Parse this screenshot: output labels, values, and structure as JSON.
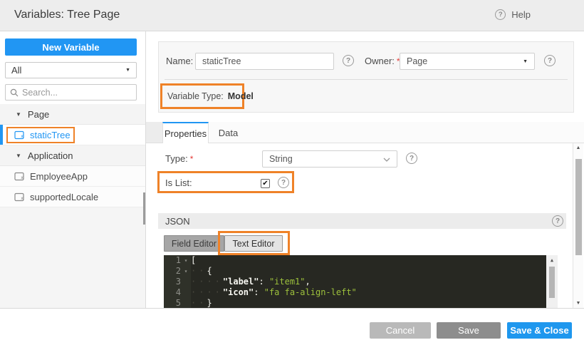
{
  "window": {
    "title": "Variables: Tree Page"
  },
  "header": {
    "help_label": "Help"
  },
  "icons": {
    "help": "?",
    "caret_down": "▼",
    "fold": "▾",
    "check": "✔",
    "scroll_up": "▲",
    "scroll_down": "▼"
  },
  "colors": {
    "accent": "#2196f3",
    "highlight_orange": "#ef8228",
    "editor_bg": "#272822",
    "string_green": "#9dc13c"
  },
  "sidebar": {
    "new_variable_button": "New Variable",
    "filter_value": "All",
    "search_placeholder": "Search...",
    "tree": [
      {
        "kind": "group",
        "label": "Page",
        "expanded": true
      },
      {
        "kind": "item",
        "label": "staticTree",
        "selected": true,
        "highlighted": true
      },
      {
        "kind": "group",
        "label": "Application",
        "expanded": true
      },
      {
        "kind": "item",
        "label": "EmployeeApp",
        "selected": false,
        "highlighted": false
      },
      {
        "kind": "item",
        "label": "supportedLocale",
        "selected": false,
        "highlighted": false
      }
    ]
  },
  "form": {
    "required_marker": "*",
    "name_label": "Name:",
    "name_value": "staticTree",
    "owner_label": "Owner:",
    "owner_value": "Page",
    "variable_type_label": "Variable Type:",
    "variable_type_value": "Model"
  },
  "tabs": {
    "properties_label": "Properties",
    "data_label": "Data",
    "active": "Properties"
  },
  "properties": {
    "type_label": "Type:",
    "type_value": "String",
    "is_list_label": "Is List:",
    "is_list_checked": true
  },
  "json_section": {
    "title": "JSON",
    "field_editor_label": "Field Editor",
    "text_editor_label": "Text Editor",
    "active_editor": "Text Editor",
    "code_lines": [
      {
        "num": "1",
        "fold": true,
        "segments": [
          {
            "c": "p",
            "t": "["
          }
        ]
      },
      {
        "num": "2",
        "fold": true,
        "segments": [
          {
            "c": "ws",
            "t": "··"
          },
          {
            "c": "p",
            "t": "{"
          }
        ]
      },
      {
        "num": "3",
        "fold": false,
        "segments": [
          {
            "c": "ws",
            "t": "····"
          },
          {
            "c": "k",
            "t": "\"label\""
          },
          {
            "c": "p",
            "t": ": "
          },
          {
            "c": "s",
            "t": "\"item1\""
          },
          {
            "c": "p",
            "t": ","
          }
        ]
      },
      {
        "num": "4",
        "fold": false,
        "segments": [
          {
            "c": "ws",
            "t": "····"
          },
          {
            "c": "k",
            "t": "\"icon\""
          },
          {
            "c": "p",
            "t": ": "
          },
          {
            "c": "s",
            "t": "\"fa fa-align-left\""
          }
        ]
      },
      {
        "num": "5",
        "fold": false,
        "segments": [
          {
            "c": "ws",
            "t": "··"
          },
          {
            "c": "p",
            "t": "}"
          }
        ]
      }
    ]
  },
  "footer": {
    "cancel_label": "Cancel",
    "save_label": "Save",
    "save_close_label": "Save & Close"
  }
}
